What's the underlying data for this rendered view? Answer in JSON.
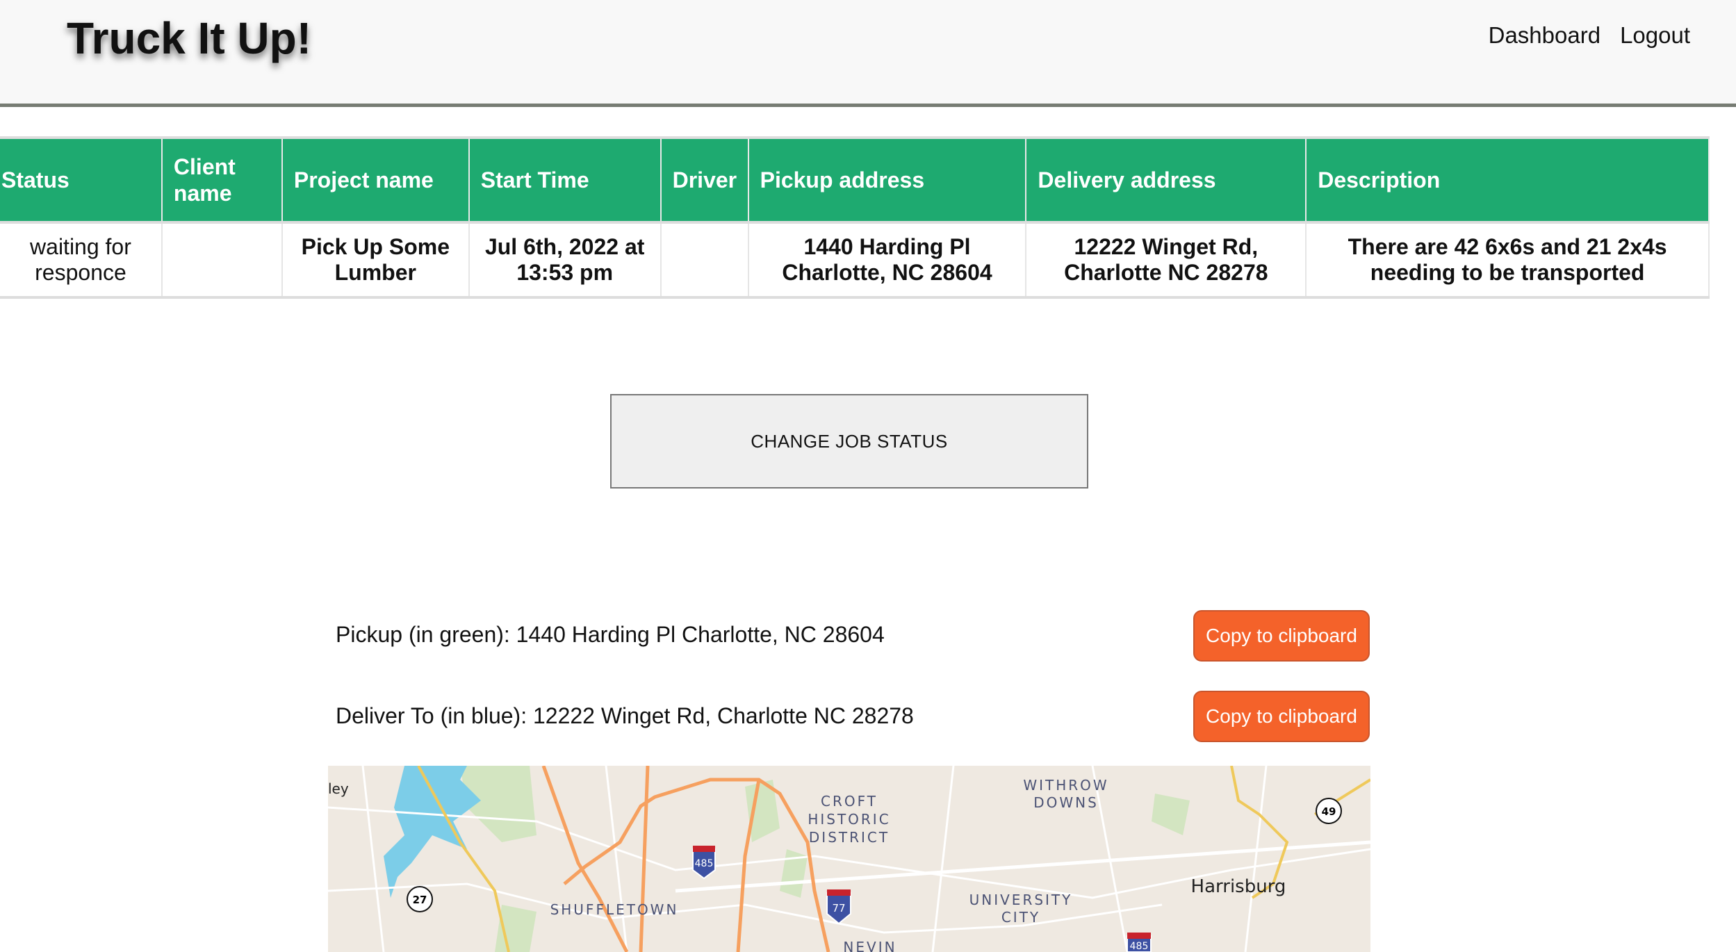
{
  "header": {
    "title": "Truck It Up!",
    "nav": [
      "Dashboard",
      "Logout"
    ]
  },
  "table": {
    "columns": [
      "Status",
      "Client name",
      "Project name",
      "Start Time",
      "Driver",
      "Pickup address",
      "Delivery address",
      "Description"
    ],
    "row": {
      "status": "waiting for responce",
      "client_name": "",
      "project_name": "Pick Up Some Lumber",
      "start_time": "Jul 6th, 2022 at 13:53 pm",
      "driver": "",
      "pickup_address": "1440 Harding Pl Charlotte, NC 28604",
      "delivery_address": "12222 Winget Rd, Charlotte NC 28278",
      "description": "There are 42 6x6s and 21 2x4s needing to be transported"
    }
  },
  "change_status_label": "CHANGE JOB STATUS",
  "pickup_line": "Pickup (in green): 1440 Harding Pl Charlotte, NC 28604",
  "deliver_line": "Deliver To (in blue): 12222 Winget Rd, Charlotte NC 28278",
  "copy_label": "Copy to clipboard",
  "map": {
    "labels": [
      "ley",
      "CROFT",
      "HISTORIC",
      "DISTRICT",
      "WITHROW",
      "DOWNS",
      "SHUFFLETOWN",
      "UNIVERSITY",
      "CITY",
      "Harrisburg",
      "NEVIN"
    ],
    "shields": [
      "485",
      "77",
      "485",
      "27",
      "49"
    ]
  },
  "colors": {
    "accent_green": "#1eaa70",
    "button_orange": "#f4622a"
  }
}
